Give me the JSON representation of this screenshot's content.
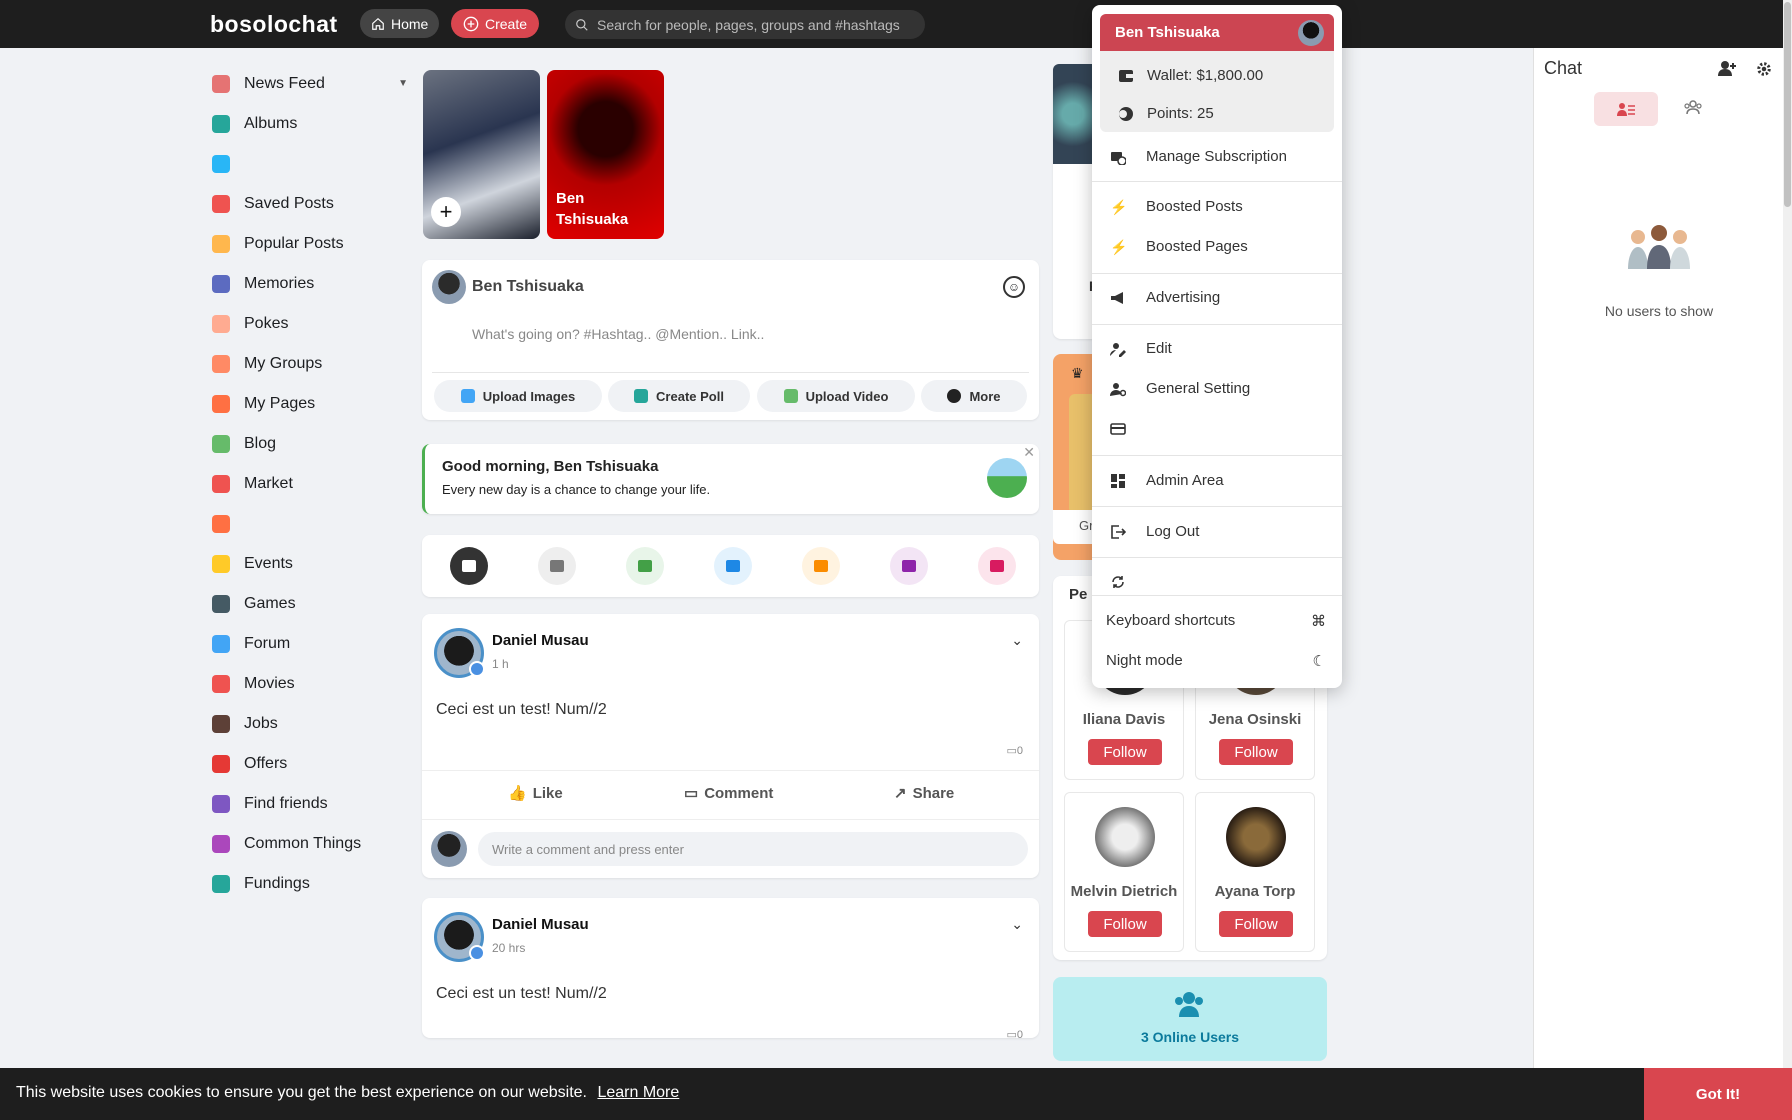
{
  "header": {
    "brand": "bosolochat",
    "home_label": "Home",
    "create_label": "Create",
    "search_placeholder": "Search for people, pages, groups and #hashtags"
  },
  "sidebar": {
    "items": [
      {
        "label": "News Feed",
        "icon": "news-feed-icon",
        "color": "#e57373"
      },
      {
        "label": "Albums",
        "icon": "albums-icon",
        "color": "#26a69a"
      },
      {
        "label": "",
        "icon": "video-icon",
        "color": "#29b6f6"
      },
      {
        "label": "Saved Posts",
        "icon": "bookmark-icon",
        "color": "#ef5350"
      },
      {
        "label": "Popular Posts",
        "icon": "fire-icon",
        "color": "#ffb74d"
      },
      {
        "label": "Memories",
        "icon": "memories-icon",
        "color": "#5c6bc0"
      },
      {
        "label": "Pokes",
        "icon": "poke-icon",
        "color": "#ffab91"
      },
      {
        "label": "My Groups",
        "icon": "groups-icon",
        "color": "#ff8a65"
      },
      {
        "label": "My Pages",
        "icon": "flag-icon",
        "color": "#ff7043"
      },
      {
        "label": "Blog",
        "icon": "blog-icon",
        "color": "#66bb6a"
      },
      {
        "label": "Market",
        "icon": "market-icon",
        "color": "#ef5350"
      },
      {
        "label": "",
        "icon": "apps-icon",
        "color": "#ff7043"
      },
      {
        "label": "Events",
        "icon": "calendar-icon",
        "color": "#ffca28"
      },
      {
        "label": "Games",
        "icon": "gamepad-icon",
        "color": "#455a64"
      },
      {
        "label": "Forum",
        "icon": "forum-icon",
        "color": "#42a5f5"
      },
      {
        "label": "Movies",
        "icon": "movies-icon",
        "color": "#ef5350"
      },
      {
        "label": "Jobs",
        "icon": "briefcase-icon",
        "color": "#5d4037"
      },
      {
        "label": "Offers",
        "icon": "offers-icon",
        "color": "#e53935"
      },
      {
        "label": "Find friends",
        "icon": "find-friends-icon",
        "color": "#7e57c2"
      },
      {
        "label": "Common Things",
        "icon": "puzzle-icon",
        "color": "#ab47bc"
      },
      {
        "label": "Fundings",
        "icon": "fundings-icon",
        "color": "#26a69a"
      }
    ]
  },
  "stories": [
    {
      "name": ""
    },
    {
      "name": "Ben Tshisuaka"
    }
  ],
  "composer": {
    "user": "Ben Tshisuaka",
    "placeholder": "What's going on? #Hashtag.. @Mention.. Link..",
    "buttons": [
      {
        "label": "Upload Images",
        "color": "#42a5f5"
      },
      {
        "label": "Create Poll",
        "color": "#26a69a"
      },
      {
        "label": "Upload Video",
        "color": "#66bb6a"
      },
      {
        "label": "More",
        "color": "#222222"
      }
    ]
  },
  "greeting": {
    "title": "Good morning, Ben Tshisuaka",
    "text": "Every new day is a chance to change your life."
  },
  "filters": [
    {
      "icon": "all-posts-icon",
      "bg": "#333333",
      "fg": "#ffffff"
    },
    {
      "icon": "text-icon",
      "bg": "#eeeeee",
      "fg": "#777777"
    },
    {
      "icon": "photos-icon",
      "bg": "#e8f5e9",
      "fg": "#43a047"
    },
    {
      "icon": "videos-icon",
      "bg": "#e3f2fd",
      "fg": "#1e88e5"
    },
    {
      "icon": "music-icon",
      "bg": "#fff3e0",
      "fg": "#fb8c00"
    },
    {
      "icon": "files-icon",
      "bg": "#f3e5f5",
      "fg": "#8e24aa"
    },
    {
      "icon": "maps-icon",
      "bg": "#fce4ec",
      "fg": "#d81b60"
    }
  ],
  "posts": [
    {
      "author": "Daniel Musau",
      "time": "1 h",
      "text": "Ceci est un test! Num//2",
      "comments": "0",
      "like": "Like",
      "comment": "Comment",
      "share": "Share",
      "comment_placeholder": "Write a comment and press enter"
    },
    {
      "author": "Daniel Musau",
      "time": "20 hrs",
      "text": "Ceci est un test! Num//2",
      "comments": "0"
    }
  ],
  "people": {
    "title": "Pe",
    "follow_label": "Follow",
    "list": [
      {
        "name": "Iliana Davis",
        "color": "#2b2b2b"
      },
      {
        "name": "Jena Osinski",
        "color": "#5a4a3a"
      },
      {
        "name": "Melvin Dietrich",
        "color": "#bdbdbd"
      },
      {
        "name": "Ayana Torp",
        "color": "#3b2a1e"
      }
    ]
  },
  "right_partial": {
    "card1_letter": "F",
    "pro_text": "Gr"
  },
  "online": {
    "label": "3 Online Users"
  },
  "chat": {
    "title": "Chat",
    "empty": "No users to show"
  },
  "menu": {
    "user": "Ben Tshisuaka",
    "wallet": "Wallet: $1,800.00",
    "points": "Points: 25",
    "items": {
      "manage_subscription": "Manage Subscription",
      "boosted_posts": "Boosted Posts",
      "boosted_pages": "Boosted Pages",
      "advertising": "Advertising",
      "edit": "Edit",
      "general_setting": "General Setting",
      "admin_area": "Admin Area",
      "log_out": "Log Out",
      "keyboard_shortcuts": "Keyboard shortcuts",
      "night_mode": "Night mode"
    }
  },
  "cookie": {
    "message": "This website uses cookies to ensure you get the best experience on our website.",
    "learn_more": "Learn More",
    "accept": "Got It!"
  }
}
